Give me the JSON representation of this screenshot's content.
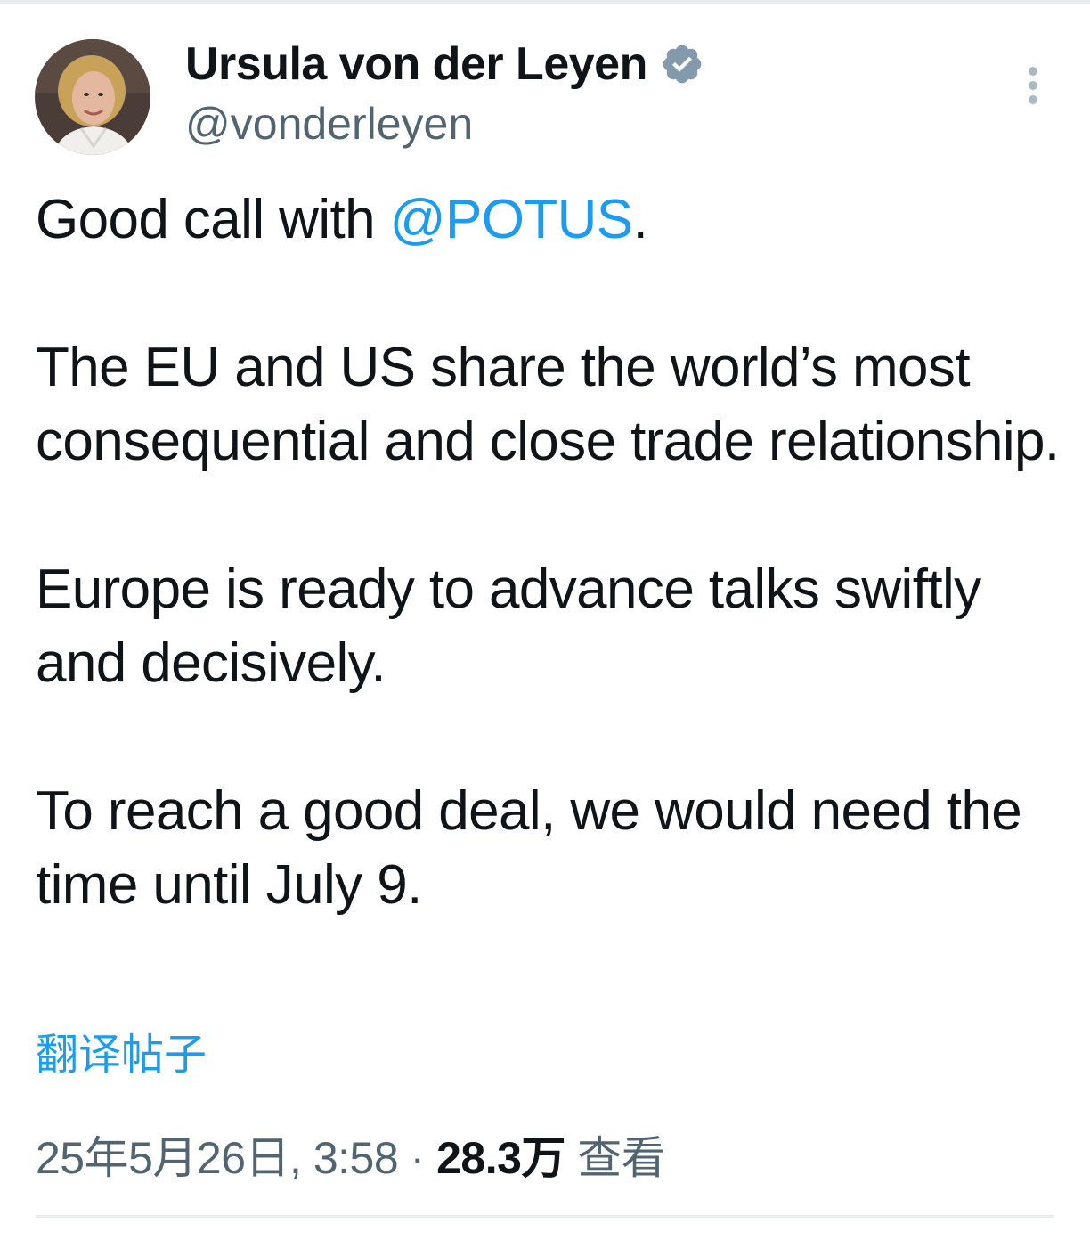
{
  "author": {
    "display_name": "Ursula von der Leyen",
    "handle": "@vonderleyen",
    "verified": true,
    "verified_color": "#829aab"
  },
  "tweet": {
    "line1_prefix": "Good call with ",
    "line1_mention": "@POTUS",
    "line1_suffix": ".",
    "paragraph2": "The EU and US share the world’s most consequential and close trade relationship.",
    "paragraph3": "Europe is ready to advance talks swiftly and decisively.",
    "paragraph4": "To reach a good deal, we would need the time until July 9."
  },
  "translate_label": "翻译帖子",
  "meta": {
    "timestamp": "25年5月26日, 3:58",
    "separator": " · ",
    "views_count": "28.3万",
    "views_label": " 查看"
  },
  "icons": {
    "verified": "verified-badge-icon",
    "more": "more-vertical-icon"
  },
  "colors": {
    "link": "#1d9bf0",
    "secondary_text": "#536471",
    "primary_text": "#0f1419"
  }
}
